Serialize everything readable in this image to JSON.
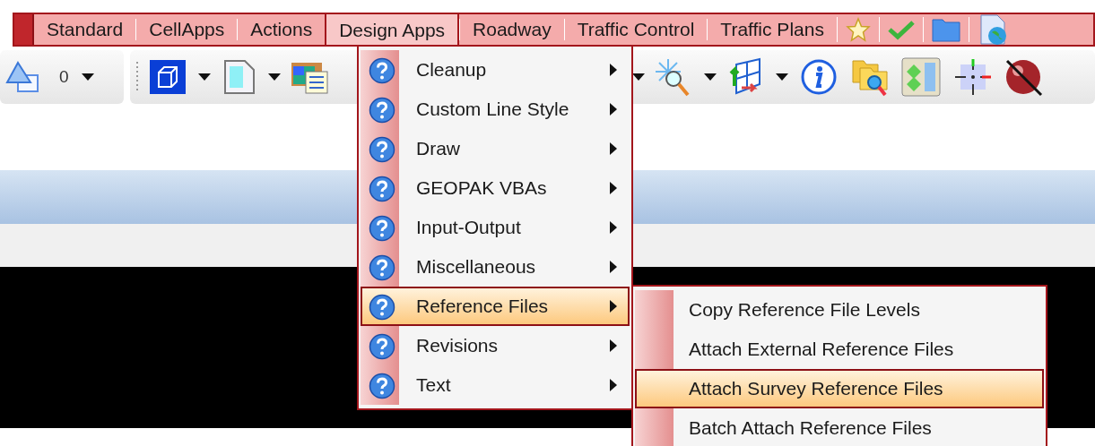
{
  "menubar": {
    "items": [
      {
        "label": "Standard",
        "selected": false
      },
      {
        "label": "CellApps",
        "selected": false
      },
      {
        "label": "Actions",
        "selected": false
      },
      {
        "label": "Design Apps",
        "selected": true
      },
      {
        "label": "Roadway",
        "selected": false
      },
      {
        "label": "Traffic Control",
        "selected": false
      },
      {
        "label": "Traffic Plans",
        "selected": false
      }
    ]
  },
  "toolbar": {
    "level_value": "0"
  },
  "menu": {
    "items": [
      {
        "label": "Cleanup",
        "selected": false
      },
      {
        "label": "Custom Line Style",
        "selected": false
      },
      {
        "label": "Draw",
        "selected": false
      },
      {
        "label": "GEOPAK VBAs",
        "selected": false
      },
      {
        "label": "Input-Output",
        "selected": false
      },
      {
        "label": "Miscellaneous",
        "selected": false
      },
      {
        "label": "Reference Files",
        "selected": true
      },
      {
        "label": "Revisions",
        "selected": false
      },
      {
        "label": "Text",
        "selected": false
      }
    ]
  },
  "submenu": {
    "items": [
      {
        "label": "Copy Reference File Levels",
        "selected": false
      },
      {
        "label": "Attach External Reference Files",
        "selected": false
      },
      {
        "label": "Attach Survey Reference Files",
        "selected": true
      },
      {
        "label": "Batch Attach Reference Files",
        "selected": false
      }
    ]
  }
}
